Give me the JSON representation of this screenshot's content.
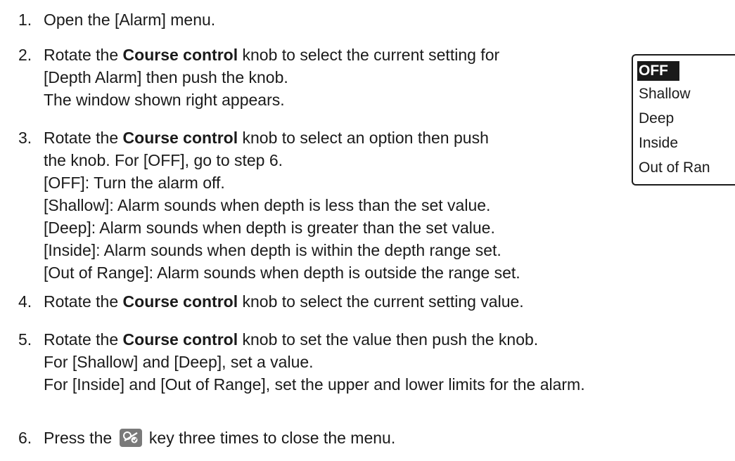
{
  "steps": [
    {
      "num": "1.",
      "lines": [
        [
          "Open the [Alarm] menu."
        ]
      ]
    },
    {
      "num": "2.",
      "lines": [
        [
          "Rotate the ",
          "Course control",
          " knob to select the current setting for"
        ],
        [
          "[Depth Alarm] then push the knob."
        ],
        [
          "The window shown right appears."
        ]
      ]
    },
    {
      "num": "3.",
      "lines": [
        [
          "Rotate the ",
          "Course control",
          " knob to select an option then push"
        ],
        [
          "the knob. For [OFF], go to step 6."
        ],
        [
          "[OFF]: Turn the alarm off."
        ],
        [
          "[Shallow]: Alarm sounds when depth is less than the set value."
        ],
        [
          "[Deep]: Alarm sounds when depth is greater than the set value."
        ],
        [
          "[Inside]: Alarm sounds when depth is within the depth range set."
        ],
        [
          "[Out of Range]: Alarm sounds when depth is outside the range set."
        ]
      ]
    },
    {
      "num": "4.",
      "lines": [
        [
          "Rotate the ",
          "Course control",
          " knob to select the current setting value."
        ]
      ]
    },
    {
      "num": "5.",
      "lines": [
        [
          "Rotate the ",
          "Course control",
          " knob to set the value then push the knob."
        ],
        [
          "For [Shallow] and [Deep], set a value."
        ],
        [
          "For [Inside] and [Out of Range], set the upper and lower limits for the alarm."
        ]
      ]
    },
    {
      "num": "6.",
      "before_key": "Press the ",
      "after_key": " key three times to close the menu.",
      "key_icon": "menu-key-icon"
    }
  ],
  "menu": {
    "items": [
      "OFF",
      "Shallow",
      "Deep",
      "Inside",
      "Out of Ran"
    ],
    "selected_index": 0
  }
}
